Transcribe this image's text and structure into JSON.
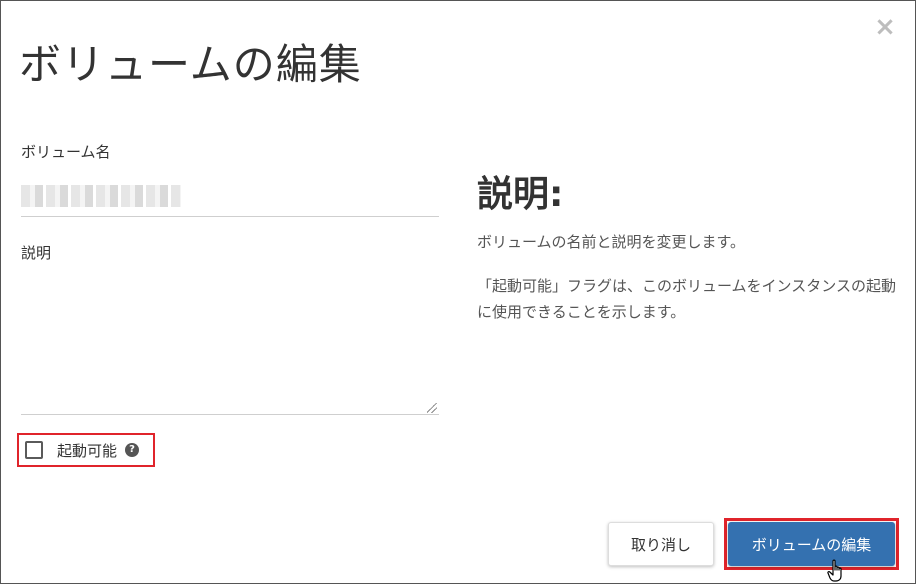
{
  "dialog": {
    "title": "ボリュームの編集",
    "close_symbol": "×"
  },
  "form": {
    "name_label": "ボリューム名",
    "name_value": "",
    "description_label": "説明",
    "description_value": "",
    "bootable_label": "起動可能",
    "bootable_checked": false,
    "help_symbol": "?"
  },
  "sidebar": {
    "heading": "説明:",
    "paragraph_1": "ボリュームの名前と説明を変更します。",
    "paragraph_2": "「起動可能」フラグは、このボリュームをインスタンスの起動に使用できることを示します。"
  },
  "footer": {
    "cancel_label": "取り消し",
    "submit_label": "ボリュームの編集"
  },
  "colors": {
    "primary": "#3471b0",
    "highlight": "#e0242b"
  },
  "icons": {
    "close": "close-icon",
    "help": "question-circle-icon",
    "cursor": "hand-pointer-cursor"
  }
}
